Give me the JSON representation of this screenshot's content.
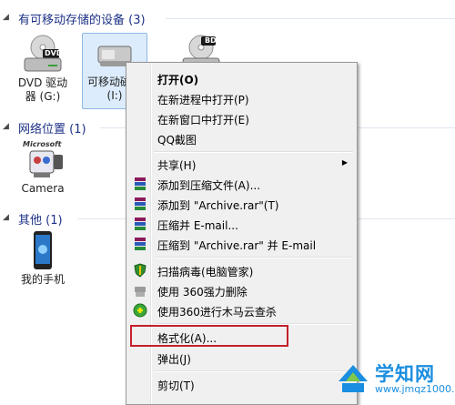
{
  "groups": {
    "removable": {
      "title": "有可移动存储的设备 (3)"
    },
    "network": {
      "title": "网络位置 (1)"
    },
    "other": {
      "title": "其他 (1)"
    }
  },
  "devices": {
    "dvd": {
      "label": "DVD 驱动器 (G:)",
      "badge": "DVD"
    },
    "removable": {
      "label": "可移动磁盘 (I:)"
    },
    "bd": {
      "badge": "BD"
    },
    "camera": {
      "label": "Camera",
      "logo": "Microsoft"
    },
    "phone": {
      "label": "我的手机"
    }
  },
  "context_menu": {
    "open": "打开(O)",
    "open_new_process": "在新进程中打开(P)",
    "open_new_window": "在新窗口中打开(E)",
    "qq_screenshot": "QQ截图",
    "share": "共享(H)",
    "add_to_archive": "添加到压缩文件(A)...",
    "add_to_rar": "添加到 \"Archive.rar\"(T)",
    "compress_email": "压缩并 E-mail...",
    "compress_rar_email": "压缩到 \"Archive.rar\" 并 E-mail",
    "scan_virus": "扫描病毒(电脑管家)",
    "force_delete_360": "使用 360强力删除",
    "trojan_scan_360": "使用360进行木马云查杀",
    "format": "格式化(A)...",
    "eject": "弹出(J)",
    "cut": "剪切(T)"
  },
  "watermark": {
    "title": "学知网",
    "url": "www.jmqz1000.com"
  },
  "colors": {
    "group_title": "#1e3287",
    "highlight_border": "#c4202b",
    "selected_bg": "#dcecfc",
    "watermark": "#1a8ee0"
  },
  "icons": [
    "chevron-down-icon",
    "dvd-drive-icon",
    "usb-drive-icon",
    "bd-drive-icon",
    "webcam-icon",
    "phone-icon",
    "winrar-icon",
    "shield-icon",
    "shredder-icon",
    "trojan-scan-icon",
    "submenu-arrow-icon",
    "logo-icon"
  ]
}
